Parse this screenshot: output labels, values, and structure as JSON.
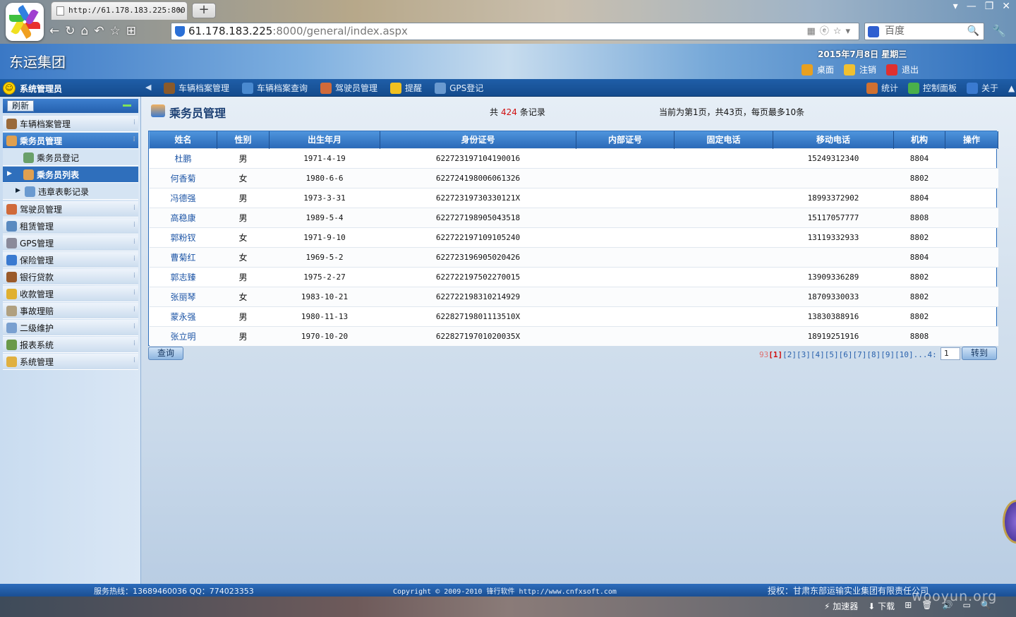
{
  "browser": {
    "tab_title": "http://61.178.183.225:800",
    "tab_close": "×",
    "new_tab": "+",
    "window_controls": [
      "▾",
      "—",
      "❐",
      "✕"
    ],
    "nav_buttons": [
      "←",
      "↻",
      "⌂",
      "↶",
      "☆",
      "⊞"
    ],
    "address_host": "61.178.183.225",
    "address_path": ":8000/general/index.aspx",
    "address_tools": "▦ⓔ☆▾",
    "search_placeholder": "百度",
    "search_icon": "🔍",
    "tools_icon": "🔧"
  },
  "header": {
    "app_title": "东运集团",
    "date": "2015年7月8日  星期三",
    "actions": [
      {
        "label": "桌面",
        "icon": "desktop-icon",
        "color": "#e8a020"
      },
      {
        "label": "注销",
        "icon": "key-icon",
        "color": "#f0c030"
      },
      {
        "label": "退出",
        "icon": "power-icon",
        "color": "#e03030"
      }
    ]
  },
  "navbar": {
    "user": "系统管理员",
    "user_icon": "☺",
    "left_arrow": "◀",
    "menu": [
      {
        "label": "车辆档案管理",
        "icon": "truck-icon",
        "color": "#8a5a2a"
      },
      {
        "label": "车辆档案查询",
        "icon": "magnifier-icon",
        "color": "#4a8ad0"
      },
      {
        "label": "驾驶员管理",
        "icon": "driver-icon",
        "color": "#d06a3a"
      },
      {
        "label": "提醒",
        "icon": "star-icon",
        "color": "#f0c020"
      },
      {
        "label": "GPS登记",
        "icon": "gps-icon",
        "color": "#6a9ad0"
      }
    ],
    "right_menu": [
      {
        "label": "统计",
        "icon": "chart-icon",
        "color": "#d07030"
      },
      {
        "label": "控制面板",
        "icon": "panel-icon",
        "color": "#4ab04a"
      },
      {
        "label": "关于",
        "icon": "info-icon",
        "color": "#3a7ad0"
      }
    ],
    "collapse_arrow": "▲"
  },
  "sidebar": {
    "refresh_label": "刷新",
    "items": [
      {
        "label": "车辆档案管理",
        "icon": "truck-icon",
        "color": "#9a6a3a",
        "active": false,
        "level": 0
      },
      {
        "label": "乘务员管理",
        "icon": "attendant-icon",
        "color": "#e0a050",
        "active": true,
        "level": 0
      },
      {
        "label": "乘务员登记",
        "icon": "form-icon",
        "color": "#6aa06a",
        "active": false,
        "level": 1
      },
      {
        "label": "乘务员列表",
        "icon": "list-icon",
        "color": "#e0a050",
        "active": true,
        "level": 1
      },
      {
        "label": "违章表彰记录",
        "icon": "record-icon",
        "color": "#6a9ad0",
        "active": false,
        "level": 1
      },
      {
        "label": "驾驶员管理",
        "icon": "driver-icon",
        "color": "#d06a3a",
        "active": false,
        "level": 0
      },
      {
        "label": "租赁管理",
        "icon": "lease-icon",
        "color": "#5a8ac0",
        "active": false,
        "level": 0
      },
      {
        "label": "GPS管理",
        "icon": "gps-icon",
        "color": "#8a8a9a",
        "active": false,
        "level": 0
      },
      {
        "label": "保险管理",
        "icon": "insurance-icon",
        "color": "#3a7ad0",
        "active": false,
        "level": 0
      },
      {
        "label": "银行贷款",
        "icon": "briefcase-icon",
        "color": "#9a5a2a",
        "active": false,
        "level": 0
      },
      {
        "label": "收款管理",
        "icon": "payment-icon",
        "color": "#e0b030",
        "active": false,
        "level": 0
      },
      {
        "label": "事故理赔",
        "icon": "accident-icon",
        "color": "#b0a080",
        "active": false,
        "level": 0
      },
      {
        "label": "二级维护",
        "icon": "maintenance-icon",
        "color": "#7aa0d0",
        "active": false,
        "level": 0
      },
      {
        "label": "报表系统",
        "icon": "report-icon",
        "color": "#6a9a4a",
        "active": false,
        "level": 0
      },
      {
        "label": "系统管理",
        "icon": "system-icon",
        "color": "#e0b040",
        "active": false,
        "level": 0
      }
    ]
  },
  "content": {
    "title": "乘务员管理",
    "record_prefix": "共",
    "record_count": "424",
    "record_suffix": "条记录",
    "page_info": "当前为第1页，共43页，每页最多10条",
    "columns": [
      "姓名",
      "性别",
      "出生年月",
      "身份证号",
      "内部证号",
      "固定电话",
      "移动电话",
      "机构",
      "操作"
    ],
    "rows": [
      [
        "杜鹏",
        "男",
        "1971-4-19",
        "622723197104190016",
        "",
        "",
        "15249312340",
        "8804",
        ""
      ],
      [
        "何香菊",
        "女",
        "1980-6-6",
        "622724198006061326",
        "",
        "",
        "",
        "8802",
        ""
      ],
      [
        "冯德强",
        "男",
        "1973-3-31",
        "62272319730330121X",
        "",
        "",
        "18993372902",
        "8804",
        ""
      ],
      [
        "高稳康",
        "男",
        "1989-5-4",
        "622727198905043518",
        "",
        "",
        "15117057777",
        "8808",
        ""
      ],
      [
        "郭粉钗",
        "女",
        "1971-9-10",
        "622722197109105240",
        "",
        "",
        "13119332933",
        "8802",
        ""
      ],
      [
        "曹菊红",
        "女",
        "1969-5-2",
        "622723196905020426",
        "",
        "",
        "",
        "8804",
        ""
      ],
      [
        "郭志臻",
        "男",
        "1975-2-27",
        "622722197502270015",
        "",
        "",
        "13909336289",
        "8802",
        ""
      ],
      [
        "张丽琴",
        "女",
        "1983-10-21",
        "622722198310214929",
        "",
        "",
        "18709330033",
        "8802",
        ""
      ],
      [
        "蒙永强",
        "男",
        "1980-11-13",
        "62282719801113510X",
        "",
        "",
        "13830388916",
        "8802",
        ""
      ],
      [
        "张立明",
        "男",
        "1970-10-20",
        "62282719701020035X",
        "",
        "",
        "18919251916",
        "8808",
        ""
      ]
    ],
    "query_label": "查询",
    "pager_prefix": "93",
    "pager_current": "[1]",
    "pager_pages": [
      "[2]",
      "[3]",
      "[4]",
      "[5]",
      "[6]",
      "[7]",
      "[8]",
      "[9]",
      "[10]"
    ],
    "pager_suffix": "...4:",
    "page_input_value": "1",
    "goto_label": "转到"
  },
  "footer": {
    "hotline": "服务热线：13689460036  QQ：774023353",
    "copyright": "Copyright © 2009-2010 锋行软件 http://www.cnfxsoft.com",
    "license": "授权：甘肃东部运输实业集团有限责任公司"
  },
  "statusbar": {
    "tools": [
      "加速器",
      "下载"
    ],
    "tool_icons": [
      "⚡",
      "⬇"
    ],
    "tray_icons": [
      "⊞",
      "🗑",
      "🔊",
      "▭",
      "🔍"
    ],
    "watermark": "wooyun.org"
  }
}
